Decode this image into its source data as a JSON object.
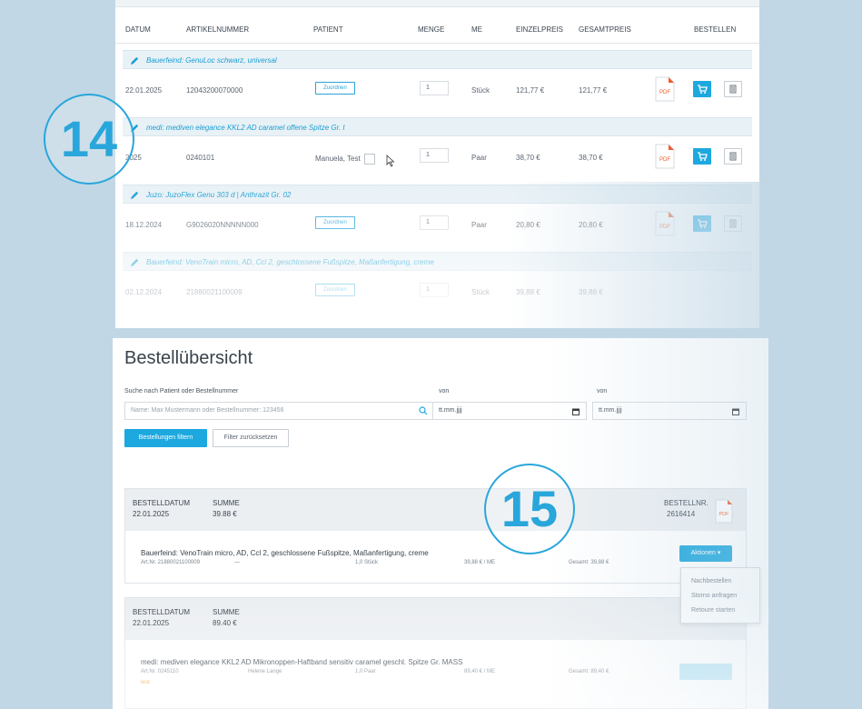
{
  "table": {
    "headers": {
      "datum": "DATUM",
      "artikelnummer": "ARTIKELNUMMER",
      "patient": "PATIENT",
      "menge": "MENGE",
      "me": "ME",
      "einzelpreis": "EINZELPREIS",
      "gesamtpreis": "GESAMTPREIS",
      "bestellen": "BESTELLEN"
    },
    "assign_label": "Zuordnen",
    "pdf_label": "PDF",
    "rows": [
      {
        "product": "Bauerfeind: GenuLoc schwarz, universal",
        "date": "22.01.2025",
        "article": "12043200070000",
        "patient": "",
        "qty": "1",
        "unit": "Stück",
        "price": "121,77 €",
        "total": "121,77 €"
      },
      {
        "product": "medi: mediven elegance KKL2 AD caramel offene Spitze Gr. I",
        "date": "2025",
        "article": "0240101",
        "patient": "Manuela, Test",
        "qty": "1",
        "unit": "Paar",
        "price": "38,70 €",
        "total": "38,70 €"
      },
      {
        "product": "Juzo: JuzoFlex Genu 303 d | Anthrazit Gr. 02",
        "date": "18.12.2024",
        "article": "G9026020NNNNN000",
        "patient": "",
        "qty": "1",
        "unit": "Paar",
        "price": "20,80 €",
        "total": "20,80 €"
      },
      {
        "product": "Bauerfeind: VenoTrain micro, AD, Ccl 2, geschlossene Fußspitze, Maßanfertigung, creme",
        "date": "02.12.2024",
        "article": "21880021100009",
        "patient": "",
        "qty": "1",
        "unit": "Stück",
        "price": "39,88 €",
        "total": "39,88 €"
      }
    ]
  },
  "badges": {
    "first": "14",
    "second": "15"
  },
  "overview": {
    "title": "Bestellübersicht",
    "search_label": "Suche nach Patient oder Bestellnummer",
    "search_placeholder": "Name: Max Mustermann oder Bestellnummer: 123456",
    "from_label": "von",
    "to_label": "von",
    "date_placeholder_1": "tt.mm.jjjj",
    "date_placeholder_2": "tt.mm.jjjj",
    "filter_button": "Bestellungen filtern",
    "reset_button": "Filter zurücksetzen",
    "orders": [
      {
        "date_label": "BESTELLDATUM",
        "date": "22.01.2025",
        "sum_label": "SUMME",
        "sum": "39.88 €",
        "ordno_label": "BESTELLNR.",
        "ordno": "2616414",
        "item": "Bauerfeind: VenoTrain micro, AD, Ccl 2, geschlossene Fußspitze, Maßanfertigung, creme",
        "art": "Art.Nr. 21880021100009",
        "patient": "—",
        "qty": "1,0 Stück",
        "price": "39,88 € / ME",
        "total": "Gesamt: 39,88 €",
        "actions": "Aktionen ▾"
      },
      {
        "date_label": "BESTELLDATUM",
        "date": "22.01.2025",
        "sum_label": "SUMME",
        "sum": "89.40 €",
        "item": "medi: mediven elegance KKL2 AD Mikronoppen-Haftband sensitiv caramel geschl. Spitze Gr. MASS",
        "art": "Art.Nr. 0245110",
        "patient": "Helene Lange",
        "qty": "1,0 Paar",
        "price": "89,40 € / ME",
        "total": "Gesamt: 89,40 €",
        "note": "test"
      }
    ],
    "menu": [
      "Nachbestellen",
      "Storno anfragen",
      "Retoure starten"
    ]
  }
}
